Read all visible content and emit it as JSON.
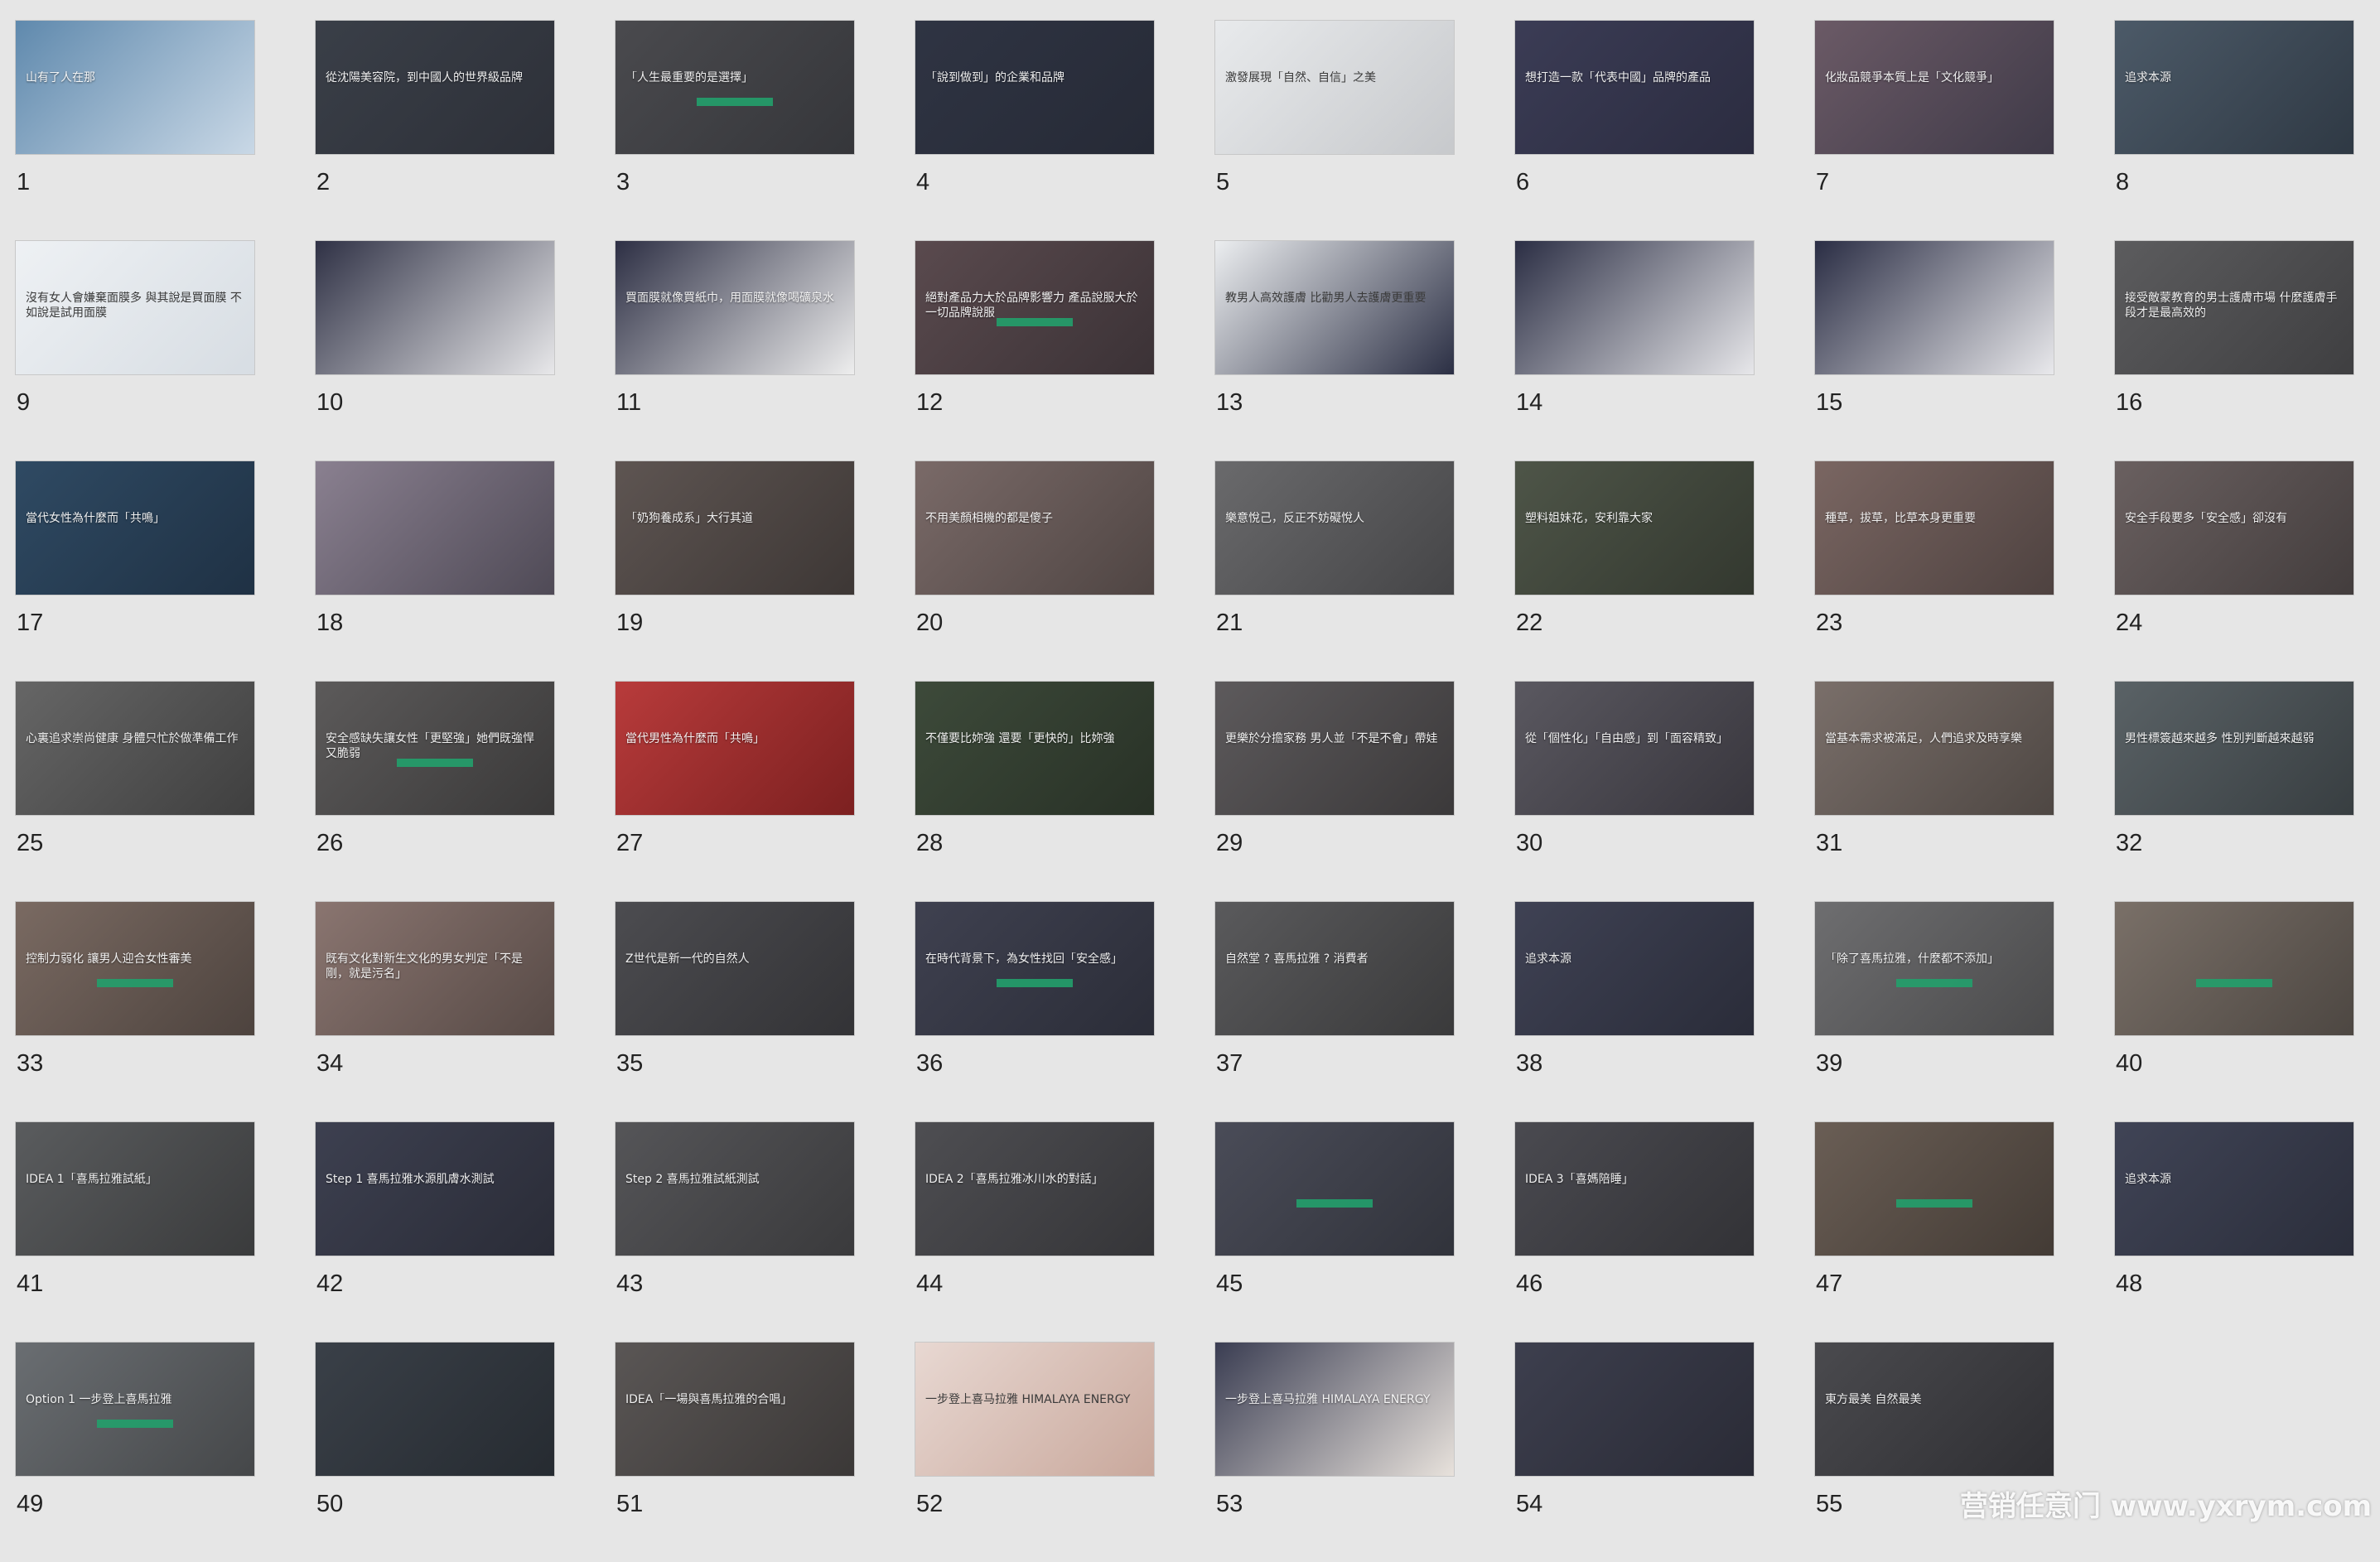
{
  "watermark": "营销任意门 www.yxrym.com",
  "slides": [
    {
      "n": "1",
      "t": "山有了人在那",
      "bg": "#5f89ad",
      "bg2": "#c9d8e6"
    },
    {
      "n": "2",
      "t": "從沈陽美容院，到中國人的世界級品牌",
      "bg": "#3a3f48",
      "bg2": "#2d3038"
    },
    {
      "n": "3",
      "t": "「人生最重要的是選擇」",
      "bg": "#4a4a4e",
      "bg2": "#35363a",
      "badge": true
    },
    {
      "n": "4",
      "t": "「說到做到」的企業和品牌",
      "bg": "#2f3443",
      "bg2": "#262a36"
    },
    {
      "n": "5",
      "t": "激發展現「自然、自信」之美",
      "bg": "#e8eaec",
      "bg2": "#c7c9cc",
      "dark": true
    },
    {
      "n": "6",
      "t": "想打造一款「代表中國」品牌的產品",
      "bg": "#3b3c55",
      "bg2": "#2b2c40"
    },
    {
      "n": "7",
      "t": "化妝品競爭本質上是「文化競爭」",
      "bg": "#6b5a66",
      "bg2": "#3f3a48"
    },
    {
      "n": "8",
      "t": "追求本源",
      "bg": "#4c5a68",
      "bg2": "#2f3944"
    },
    {
      "n": "9",
      "t": "沒有女人會嫌棄面膜多 與其說是買面膜 不如說是試用面膜",
      "bg": "#eef1f4",
      "bg2": "#d7dde3",
      "dark": true
    },
    {
      "n": "10",
      "t": "",
      "bg": "#2f3145",
      "bg2": "#e8e8ea"
    },
    {
      "n": "11",
      "t": "買面膜就像買紙巾，用面膜就像喝礦泉水",
      "bg": "#2d2f44",
      "bg2": "#eeeeee"
    },
    {
      "n": "12",
      "t": "絕對產品力大於品牌影響力 產品說服大於一切品牌說服",
      "bg": "#5a4a4e",
      "bg2": "#3b3236",
      "badge": true
    },
    {
      "n": "13",
      "t": "教男人高效護膚 比勸男人去護膚更重要",
      "bg": "#eceef0",
      "bg2": "#2b2f44",
      "dark": true
    },
    {
      "n": "14",
      "t": "",
      "bg": "#2b2e44",
      "bg2": "#e7e7ea"
    },
    {
      "n": "15",
      "t": "",
      "bg": "#2a2d44",
      "bg2": "#e9e9ec"
    },
    {
      "n": "16",
      "t": "接受敵蒙教育的男士護膚市場 什麼護膚手段才是最高效的",
      "bg": "#5c5c5e",
      "bg2": "#3f3f41"
    },
    {
      "n": "17",
      "t": "當代女性為什麼而「共鳴」",
      "bg": "#2f4a63",
      "bg2": "#1f3144"
    },
    {
      "n": "18",
      "t": "",
      "bg": "#8a8090",
      "bg2": "#4f4a56"
    },
    {
      "n": "19",
      "t": "「奶狗養成系」大行其道",
      "bg": "#5e5552",
      "bg2": "#3d3735"
    },
    {
      "n": "20",
      "t": "不用美顏相機的都是傻子",
      "bg": "#7a6a68",
      "bg2": "#4f4543"
    },
    {
      "n": "21",
      "t": "樂意悅己，反正不妨礙悅人",
      "bg": "#6a6a6c",
      "bg2": "#454547"
    },
    {
      "n": "22",
      "t": "塑料姐妹花，安利靠大家",
      "bg": "#4e5548",
      "bg2": "#33382f"
    },
    {
      "n": "23",
      "t": "種草，拔草，比草本身更重要",
      "bg": "#7a6662",
      "bg2": "#4e4240"
    },
    {
      "n": "24",
      "t": "安全手段要多「安全感」卻沒有",
      "bg": "#6a6060",
      "bg2": "#433d3d"
    },
    {
      "n": "25",
      "t": "心裏追求崇尚健康 身體只忙於做準備工作",
      "bg": "#666666",
      "bg2": "#3f3f3f"
    },
    {
      "n": "26",
      "t": "安全感缺失讓女性「更堅強」她們既強悍又脆弱",
      "bg": "#5c5a5a",
      "bg2": "#3a3939",
      "badge": true
    },
    {
      "n": "27",
      "t": "當代男性為什麼而「共鳴」",
      "bg": "#b83b3b",
      "bg2": "#7c2020"
    },
    {
      "n": "28",
      "t": "不僅要比妳強 還要「更快的」比妳強",
      "bg": "#3d4a3a",
      "bg2": "#283126"
    },
    {
      "n": "29",
      "t": "更樂於分擔家務 男人並「不是不會」帶娃",
      "bg": "#5d5a5c",
      "bg2": "#3b393a"
    },
    {
      "n": "30",
      "t": "從「個性化」「自由感」到「面容精致」",
      "bg": "#5a5860",
      "bg2": "#38363d"
    },
    {
      "n": "31",
      "t": "當基本需求被滿足，人們追求及時享樂",
      "bg": "#7a6f6a",
      "bg2": "#4e4743"
    },
    {
      "n": "32",
      "t": "男性標簽越來越多 性別判斷越來越弱",
      "bg": "#5a6266",
      "bg2": "#383e41"
    },
    {
      "n": "33",
      "t": "控制力弱化 讓男人迎合女性審美",
      "bg": "#7a6a62",
      "bg2": "#4d433e",
      "badge": true
    },
    {
      "n": "34",
      "t": "既有文化對新生文化的男女判定「不是剛，就是污名」",
      "bg": "#8a7570",
      "bg2": "#574a46"
    },
    {
      "n": "35",
      "t": "Z世代是新一代的自然人",
      "bg": "#4c4c50",
      "bg2": "#333336"
    },
    {
      "n": "36",
      "t": "在時代背景下，為女性找回「安全感」",
      "bg": "#3f4150",
      "bg2": "#2b2d38",
      "badge": true
    },
    {
      "n": "37",
      "t": "自然堂 ? 喜馬拉雅 ? 消費者",
      "bg": "#5a5a5c",
      "bg2": "#3a3a3b"
    },
    {
      "n": "38",
      "t": "追求本源",
      "bg": "#3f4254",
      "bg2": "#2a2c39"
    },
    {
      "n": "39",
      "t": "「除了喜馬拉雅，什麼都不添加」",
      "bg": "#6e6e70",
      "bg2": "#4a4a4b",
      "badge": true
    },
    {
      "n": "40",
      "t": "",
      "bg": "#7a7068",
      "bg2": "#4d4742",
      "badge": true
    },
    {
      "n": "41",
      "t": "IDEA 1「喜馬拉雅試紙」",
      "bg": "#5a5c5e",
      "bg2": "#3a3b3c"
    },
    {
      "n": "42",
      "t": "Step 1 喜馬拉雅水源肌膚水測試",
      "bg": "#3d4050",
      "bg2": "#2a2c37"
    },
    {
      "n": "43",
      "t": "Step 2 喜馬拉雅試紙測試",
      "bg": "#555558",
      "bg2": "#3a3a3c"
    },
    {
      "n": "44",
      "t": "IDEA 2「喜馬拉雅冰川水的對話」",
      "bg": "#4e4e52",
      "bg2": "#353538"
    },
    {
      "n": "45",
      "t": "",
      "bg": "#4a4c58",
      "bg2": "#31333b",
      "badge": true
    },
    {
      "n": "46",
      "t": "IDEA 3「喜媽陪睡」",
      "bg": "#4a4a50",
      "bg2": "#323236"
    },
    {
      "n": "47",
      "t": "",
      "bg": "#6a5e55",
      "bg2": "#433b35",
      "badge": true
    },
    {
      "n": "48",
      "t": "追求本源",
      "bg": "#404456",
      "bg2": "#2b2e3b"
    },
    {
      "n": "49",
      "t": "Option 1 一步登上喜馬拉雅",
      "bg": "#6a6e72",
      "bg2": "#454749",
      "badge": true
    },
    {
      "n": "50",
      "t": "",
      "bg": "#3a4048",
      "bg2": "#262b31"
    },
    {
      "n": "51",
      "t": "IDEA「一場與喜馬拉雅的合唱」",
      "bg": "#5a5655",
      "bg2": "#3b3837"
    },
    {
      "n": "52",
      "t": "一步登上喜马拉雅 HIMALAYA ENERGY",
      "bg": "#e8d8d2",
      "bg2": "#c9a89c",
      "dark": true
    },
    {
      "n": "53",
      "t": "一步登上喜马拉雅 HIMALAYA ENERGY",
      "bg": "#3a3d52",
      "bg2": "#e8e2dc"
    },
    {
      "n": "54",
      "t": "",
      "bg": "#3d3f4e",
      "bg2": "#2a2b36"
    },
    {
      "n": "55",
      "t": "東方最美 自然最美",
      "bg": "#4a4a4e",
      "bg2": "#2f2f33"
    }
  ]
}
